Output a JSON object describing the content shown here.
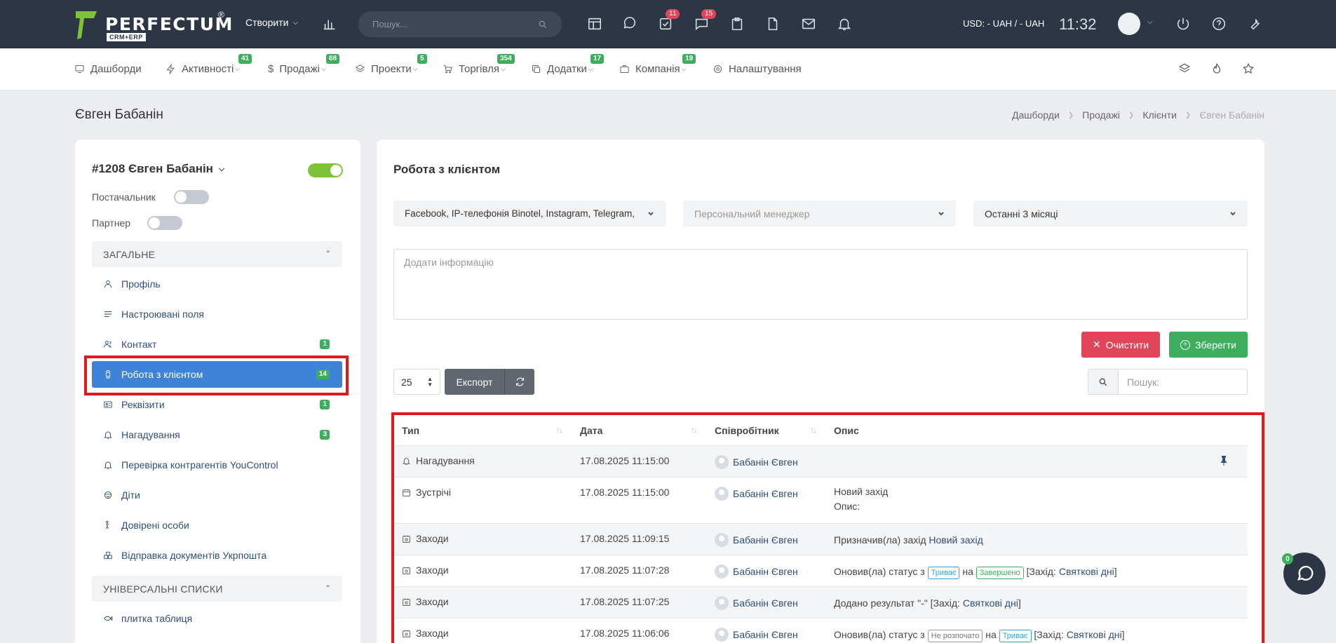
{
  "topbar": {
    "logo_text": "PERFECTUM",
    "logo_reg": "®",
    "logo_sub": "CRM+ERP",
    "create_label": "Створити",
    "search_placeholder": "Пошук...",
    "badge_tasks": "11",
    "badge_chat": "15",
    "currency": "USD: - UAH / - UAH",
    "time": "11:32"
  },
  "nav": [
    {
      "label": "Дашборди",
      "badge": ""
    },
    {
      "label": "Активності",
      "badge": "41"
    },
    {
      "label": "Продажі",
      "badge": "68"
    },
    {
      "label": "Проекти",
      "badge": "5"
    },
    {
      "label": "Торгівля",
      "badge": "354"
    },
    {
      "label": "Додатки",
      "badge": "17"
    },
    {
      "label": "Компанія",
      "badge": "19"
    },
    {
      "label": "Налаштування",
      "badge": ""
    }
  ],
  "page": {
    "title": "Євген Бабанін",
    "breadcrumb": [
      "Дашборди",
      "Продажі",
      "Клієнти",
      "Євген Бабанін"
    ]
  },
  "sidebar": {
    "client_name": "#1208 Євген Бабанін",
    "supplier_label": "Постачальник",
    "partner_label": "Партнер",
    "section_general": "ЗАГАЛЬНЕ",
    "section_lists": "УНІВЕРСАЛЬНІ СПИСКИ",
    "items": [
      {
        "label": "Профіль",
        "count": ""
      },
      {
        "label": "Настроювані поля",
        "count": ""
      },
      {
        "label": "Контакт",
        "count": "1"
      },
      {
        "label": "Робота з клієнтом",
        "count": "14"
      },
      {
        "label": "Реквізити",
        "count": "1"
      },
      {
        "label": "Нагадування",
        "count": "3"
      },
      {
        "label": "Перевірка контрагентів YouControl",
        "count": ""
      },
      {
        "label": "Діти",
        "count": ""
      },
      {
        "label": "Довірені особи",
        "count": ""
      },
      {
        "label": "Відправка документів Укрпошта",
        "count": ""
      }
    ],
    "list_items": [
      {
        "label": "плитка таблиця"
      }
    ]
  },
  "main": {
    "title": "Робота з клієнтом",
    "filter_channels": "Facebook, IP-телефонія Binotel, Instagram, Telegram,",
    "filter_manager_placeholder": "Персональний менеджер",
    "filter_period": "Останні 3 місяці",
    "textarea_placeholder": "Додати інформацію",
    "clear_label": "Очистити",
    "save_label": "Зберегти",
    "page_size": "25",
    "export_label": "Експорт",
    "search_placeholder": "Пошук:"
  },
  "table": {
    "headers": [
      "Тип",
      "Дата",
      "Співробітник",
      "Опис"
    ],
    "rows": [
      {
        "type": "Нагадування",
        "date": "17.08.2025 11:15:00",
        "employee": "Бабанін Євген"
      },
      {
        "type": "Зустрічі",
        "date": "17.08.2025 11:15:00",
        "employee": "Бабанін Євген",
        "desc1": "Новий захід",
        "desc2": "Опис:"
      },
      {
        "type": "Заходи",
        "date": "17.08.2025 11:09:15",
        "employee": "Бабанін Євген",
        "desc_pre": "Призначив(ла) захід",
        "desc_link": "Новий захід"
      },
      {
        "type": "Заходи",
        "date": "17.08.2025 11:07:28",
        "employee": "Бабанін Євген",
        "desc_pre": "Оновив(ла) статус з",
        "tag_from": "Триває",
        "mid": "на",
        "tag_to": "Завершено",
        "br_open": "[Захід:",
        "desc_link": "Святкові дні",
        "br_close": "]"
      },
      {
        "type": "Заходи",
        "date": "17.08.2025 11:07:25",
        "employee": "Бабанін Євген",
        "desc_pre": "Додано результат \"-\" [Захід:",
        "desc_link": "Святкові дні",
        "br_close": "]"
      },
      {
        "type": "Заходи",
        "date": "17.08.2025 11:06:06",
        "employee": "Бабанін Євген",
        "desc_pre": "Оновив(ла) статус з",
        "tag_from": "Не розпочато",
        "mid": "на",
        "tag_to": "Триває",
        "br_open": "[Захід:",
        "desc_link": "Святкові дні",
        "br_close": "]"
      }
    ]
  },
  "chat": {
    "badge": "0"
  },
  "colors": {
    "topbar": "#2d3644",
    "accent": "#3f83d8",
    "badge_green": "#3eae5e",
    "danger": "#e0455a",
    "highlight": "#e01a22"
  }
}
